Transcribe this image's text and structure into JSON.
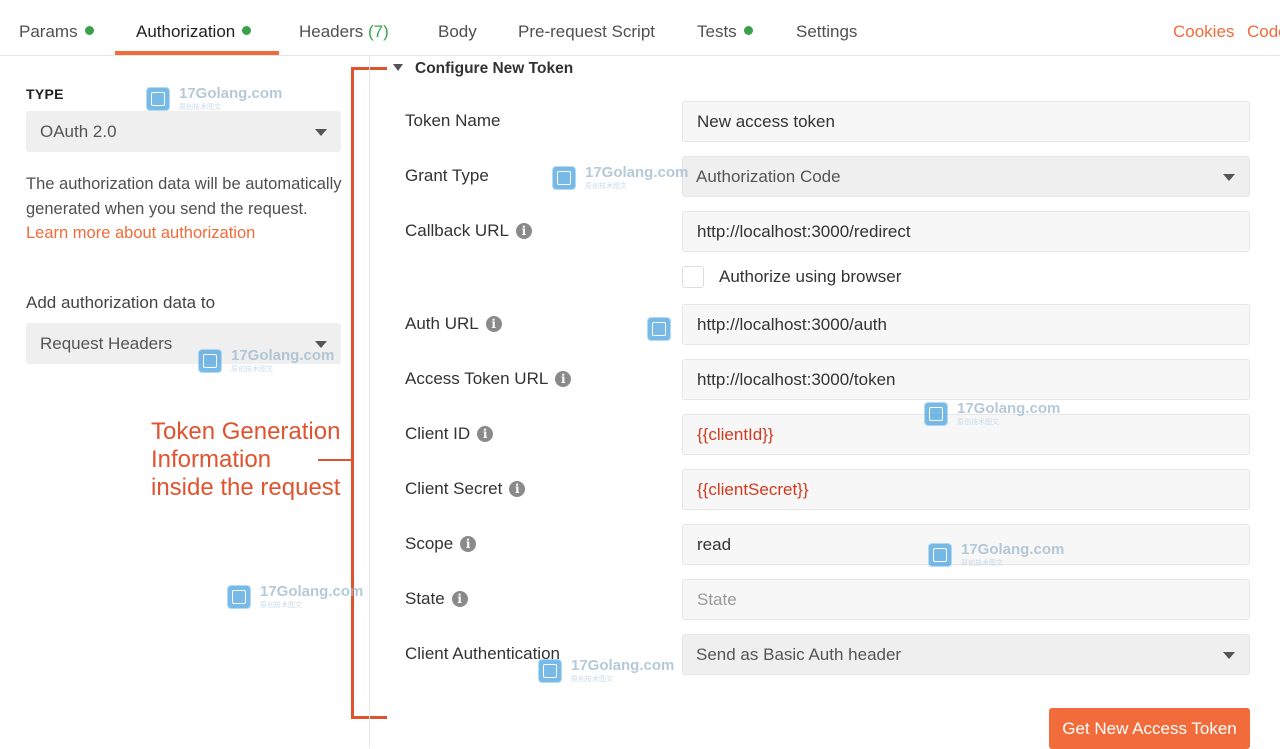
{
  "tabs": [
    {
      "label": "Params",
      "dot": true
    },
    {
      "label": "Authorization",
      "dot": true,
      "active": true
    },
    {
      "label": "Headers",
      "count": "(7)"
    },
    {
      "label": "Body"
    },
    {
      "label": "Pre-request Script"
    },
    {
      "label": "Tests",
      "dot": true
    },
    {
      "label": "Settings"
    }
  ],
  "top_links": {
    "cookies": "Cookies",
    "code": "Code"
  },
  "left": {
    "type_label": "TYPE",
    "type_value": "OAuth 2.0",
    "description": "The authorization data will be automatically generated when you send the request.",
    "learn_more": "Learn more about authorization",
    "add_label": "Add authorization data to",
    "add_value": "Request Headers"
  },
  "annotation": {
    "line1": "Token Generation",
    "line2": "Information",
    "line3": "inside the request"
  },
  "section": {
    "title": "Configure New Token"
  },
  "form": {
    "token_name": {
      "label": "Token Name",
      "value": "New access token"
    },
    "grant_type": {
      "label": "Grant Type",
      "value": "Authorization Code"
    },
    "callback_url": {
      "label": "Callback URL",
      "value": "http://localhost:3000/redirect"
    },
    "authorize_browser": {
      "label": "Authorize using browser",
      "checked": false
    },
    "auth_url": {
      "label": "Auth URL",
      "value": "http://localhost:3000/auth"
    },
    "access_token_url": {
      "label": "Access Token URL",
      "value": "http://localhost:3000/token"
    },
    "client_id": {
      "label": "Client ID",
      "value": "{{clientId}}"
    },
    "client_secret": {
      "label": "Client Secret",
      "value": "{{clientSecret}}"
    },
    "scope": {
      "label": "Scope",
      "value": "read"
    },
    "state": {
      "label": "State",
      "placeholder": "State"
    },
    "client_auth": {
      "label": "Client Authentication",
      "value": "Send as Basic Auth header"
    }
  },
  "buttons": {
    "get_token": "Get New Access Token"
  },
  "watermark": {
    "text": "17Golang.com",
    "sub": "原创技术图文"
  },
  "colors": {
    "accent": "#f26b3a",
    "status_dot": "#3aa14b",
    "variable": "#d23a1e",
    "annotation": "#e0532f"
  }
}
